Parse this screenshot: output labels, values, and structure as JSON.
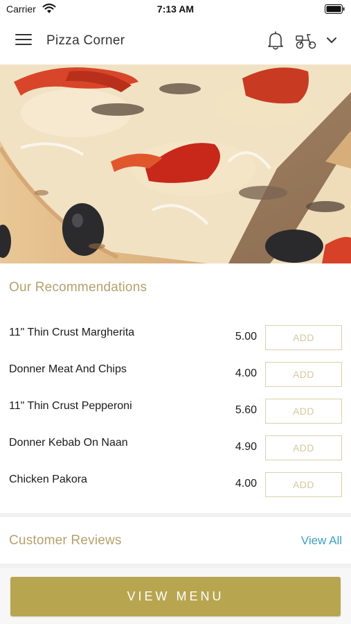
{
  "status_bar": {
    "carrier": "Carrier",
    "time": "7:13 AM"
  },
  "header": {
    "title": "Pizza Corner",
    "icons": [
      "menu-icon",
      "bell-icon",
      "delivery-scooter-icon",
      "chevron-down-icon"
    ]
  },
  "recommendations": {
    "title": "Our Recommendations",
    "add_label": "ADD",
    "items": [
      {
        "name": "11\" Thin Crust Margherita",
        "price": "5.00"
      },
      {
        "name": "Donner Meat And Chips",
        "price": "4.00"
      },
      {
        "name": "11\" Thin Crust Pepperoni",
        "price": "5.60"
      },
      {
        "name": "Donner Kebab On Naan",
        "price": "4.90"
      },
      {
        "name": "Chicken Pakora",
        "price": "4.00"
      }
    ]
  },
  "reviews": {
    "title": "Customer Reviews",
    "view_all": "View All"
  },
  "footer": {
    "view_menu": "VIEW MENU"
  },
  "colors": {
    "accent_gold": "#b8a54f",
    "section_title": "#b3a16c",
    "link_blue": "#3e9fc6"
  }
}
